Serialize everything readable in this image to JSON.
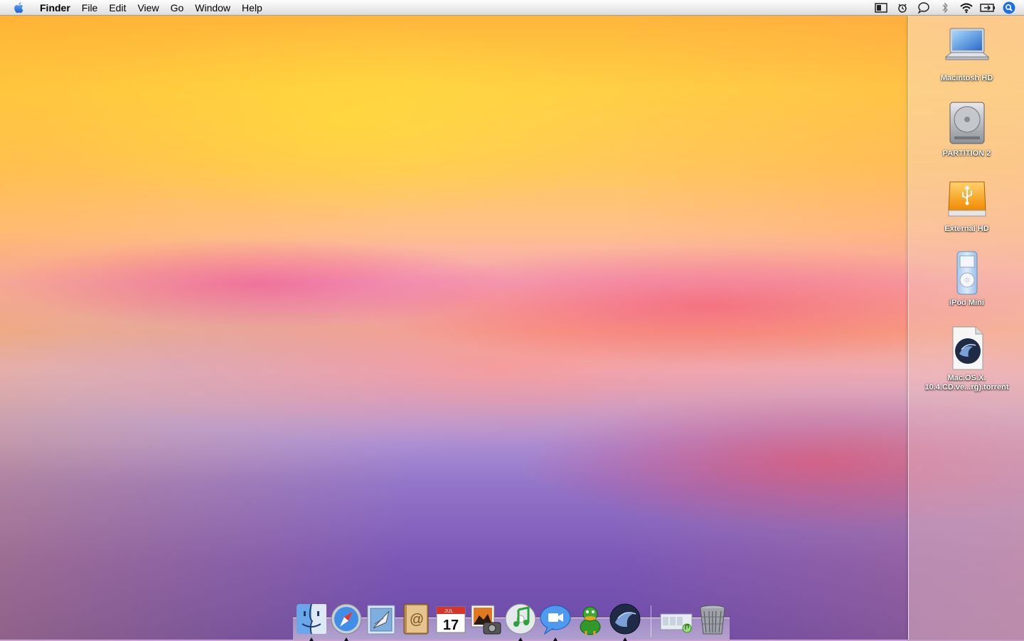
{
  "menubar": {
    "apple_icon": "apple-icon",
    "app_name": "Finder",
    "menus": [
      "File",
      "Edit",
      "View",
      "Go",
      "Window",
      "Help"
    ],
    "status_icons": [
      "spaces-icon",
      "syncing-icon",
      "chat-icon",
      "bluetooth-icon",
      "wifi-icon",
      "battery-icon",
      "spotlight-icon"
    ]
  },
  "desktop": {
    "icons": [
      {
        "label": "Macintosh HD",
        "icon": "laptop-drive-icon"
      },
      {
        "label": "PARTITION 2",
        "icon": "hard-drive-icon"
      },
      {
        "label": "External HD",
        "icon": "usb-drive-icon"
      },
      {
        "label": "iPod Mini",
        "icon": "ipod-icon"
      },
      {
        "label_line1": "Mac.OS.X.",
        "label_line2": "10.4.CD.ve...rg).torrent",
        "icon": "torrent-file-icon"
      }
    ]
  },
  "dock": {
    "items": [
      {
        "name": "finder",
        "icon": "finder-icon",
        "running": true
      },
      {
        "name": "safari",
        "icon": "safari-icon",
        "running": true
      },
      {
        "name": "mail",
        "icon": "mail-icon",
        "running": false
      },
      {
        "name": "address-book",
        "icon": "address-book-icon",
        "running": false
      },
      {
        "name": "ical",
        "icon": "ical-icon",
        "running": false,
        "month": "JUL",
        "day": "17"
      },
      {
        "name": "iphoto",
        "icon": "iphoto-icon",
        "running": false
      },
      {
        "name": "itunes",
        "icon": "itunes-icon",
        "running": true
      },
      {
        "name": "ichat",
        "icon": "ichat-icon",
        "running": true
      },
      {
        "name": "adium",
        "icon": "adium-icon",
        "running": false
      },
      {
        "name": "bittorrent",
        "icon": "torrent-app-icon",
        "running": true
      },
      {
        "name": "music-folder",
        "icon": "music-stack-icon",
        "running": false
      },
      {
        "name": "trash",
        "icon": "trash-icon",
        "running": false
      }
    ]
  }
}
